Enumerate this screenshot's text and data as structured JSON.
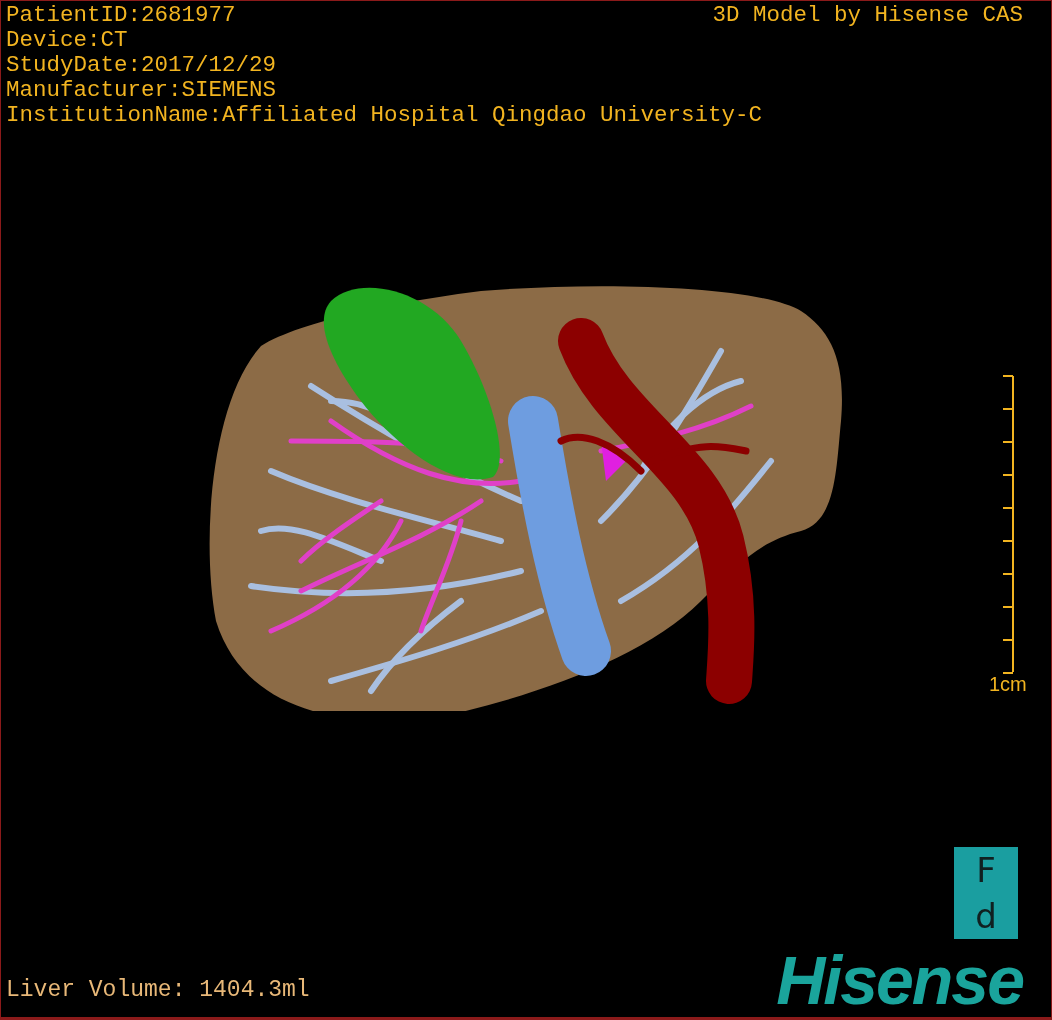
{
  "info_lines": [
    "PatientID:2681977",
    "Device:CT",
    "StudyDate:2017/12/29",
    "Manufacturer:SIEMENS",
    "InstitutionName:Affiliated Hospital Qingdao University-C"
  ],
  "title": "3D Model by Hisense CAS",
  "scale_bar": {
    "label": "1cm"
  },
  "orientation_marker": {
    "top": "F",
    "bottom": "d"
  },
  "liver_volume": "Liver Volume: 1404.3ml",
  "logo": "Hisense"
}
